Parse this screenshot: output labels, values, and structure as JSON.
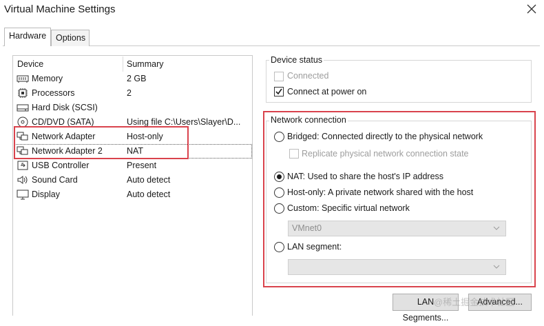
{
  "window": {
    "title": "Virtual Machine Settings",
    "close_icon": "close-icon"
  },
  "tabs": [
    {
      "label": "Hardware",
      "active": true
    },
    {
      "label": "Options",
      "active": false
    }
  ],
  "device_list": {
    "columns": [
      "Device",
      "Summary"
    ],
    "rows": [
      {
        "device": "Memory",
        "summary": "2 GB",
        "icon": "memory-icon"
      },
      {
        "device": "Processors",
        "summary": "2",
        "icon": "processor-icon"
      },
      {
        "device": "Hard Disk (SCSI)",
        "summary": "",
        "icon": "hard-disk-icon"
      },
      {
        "device": "CD/DVD (SATA)",
        "summary": "Using file C:\\Users\\Slayer\\D...",
        "icon": "cd-dvd-icon"
      },
      {
        "device": "Network Adapter",
        "summary": "Host-only",
        "icon": "network-adapter-icon"
      },
      {
        "device": "Network Adapter 2",
        "summary": "NAT",
        "icon": "network-adapter-icon",
        "selected": true
      },
      {
        "device": "USB Controller",
        "summary": "Present",
        "icon": "usb-icon"
      },
      {
        "device": "Sound Card",
        "summary": "Auto detect",
        "icon": "speaker-icon"
      },
      {
        "device": "Display",
        "summary": "Auto detect",
        "icon": "display-icon"
      }
    ]
  },
  "device_status": {
    "title": "Device status",
    "connected": {
      "label": "Connected",
      "checked": false,
      "disabled": true
    },
    "connect_at_power_on": {
      "label": "Connect at power on",
      "checked": true
    }
  },
  "network_connection": {
    "title": "Network connection",
    "bridged": {
      "label": "Bridged: Connected directly to the physical network",
      "selected": false
    },
    "replicate": {
      "label": "Replicate physical network connection state",
      "checked": false,
      "disabled": true
    },
    "nat": {
      "label": "NAT: Used to share the host's IP address",
      "selected": true
    },
    "host_only": {
      "label": "Host-only: A private network shared with the host",
      "selected": false
    },
    "custom": {
      "label": "Custom: Specific virtual network",
      "selected": false
    },
    "custom_select": {
      "value": "VMnet0",
      "disabled": true
    },
    "lan_segment": {
      "label": "LAN segment:",
      "selected": false
    },
    "lan_segment_select": {
      "value": "",
      "disabled": true
    }
  },
  "buttons": {
    "lan_segments": "LAN Segments...",
    "advanced": "Advanced..."
  },
  "watermark": "@稀土掘金技术社区",
  "colors": {
    "highlight_box": "#d9424c"
  }
}
